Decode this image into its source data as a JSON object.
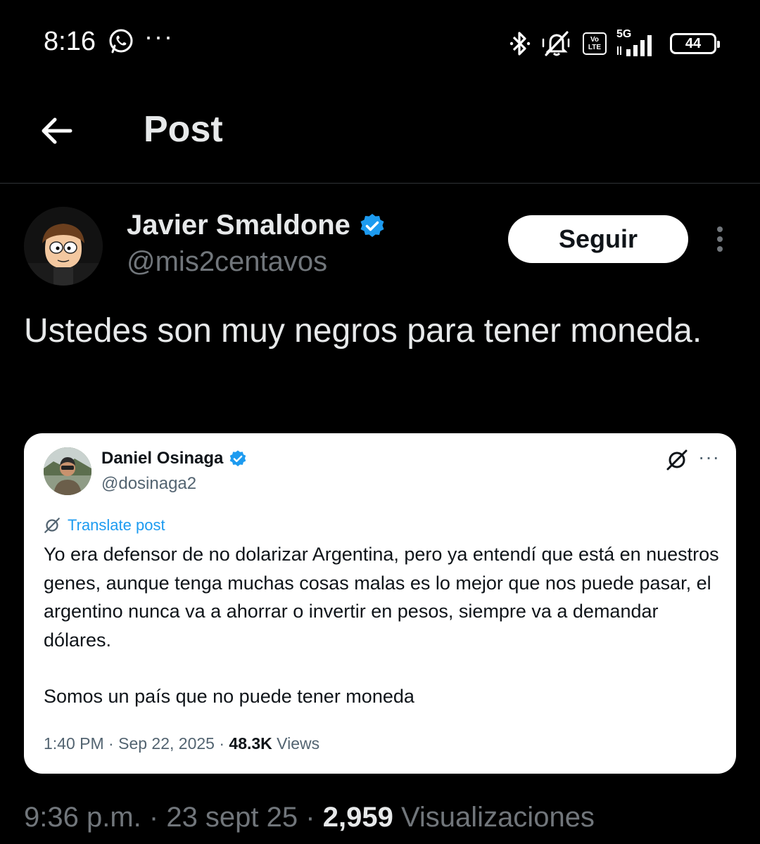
{
  "status_bar": {
    "time": "8:16",
    "more_indicator": "···",
    "icons": [
      "whatsapp-icon",
      "bluetooth-icon",
      "muted-bell-icon",
      "volte-icon",
      "5g-signal-icon"
    ],
    "network_type": "5G",
    "volte_label": "Vo LTE",
    "battery_level": "44"
  },
  "header": {
    "title": "Post",
    "back_icon": "arrow-left-icon"
  },
  "post": {
    "author": {
      "name": "Javier Smaldone",
      "handle": "@mis2centavos",
      "verified": true
    },
    "follow_label": "Seguir",
    "text": "Ustedes son muy negros para tener moneda.",
    "timestamp_time": "9:36 p.m.",
    "timestamp_date": "23 sept 25",
    "views_count": "2,959",
    "views_label": "Visualizaciones"
  },
  "quoted_post": {
    "author": {
      "name": "Daniel Osinaga",
      "handle": "@dosinaga2",
      "verified": true
    },
    "translate_label": "Translate post",
    "paragraph_1": "Yo era defensor de no dolarizar Argentina, pero ya entendí que está en nuestros genes, aunque tenga muchas cosas malas es lo mejor que nos puede pasar, el argentino nunca va a ahorrar o invertir en pesos, siempre va a demandar dólares.",
    "paragraph_2": "Somos un país que no puede tener moneda",
    "time": "1:40 PM",
    "date": "Sep 22, 2025",
    "views_count": "48.3K",
    "views_label": "Views"
  },
  "colors": {
    "background": "#000000",
    "text_primary": "#e7e9ea",
    "text_secondary": "#71767b",
    "verified": "#1d9bf0",
    "card_background": "#ffffff"
  }
}
